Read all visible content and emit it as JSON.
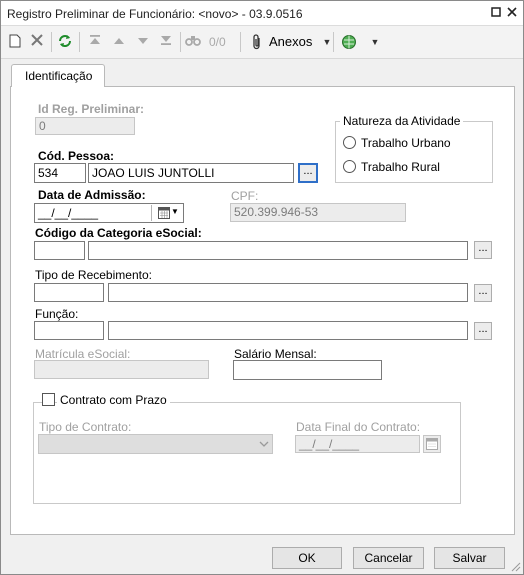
{
  "window": {
    "title": "Registro Preliminar de Funcionário: <novo> - 03.9.0516"
  },
  "toolbar": {
    "record_counter": "0/0",
    "attachments_label": "Anexos"
  },
  "tabs": [
    {
      "label": "Identificação"
    }
  ],
  "form": {
    "id_reg_preliminar": {
      "label": "Id Reg. Preliminar:",
      "value": "0"
    },
    "natureza": {
      "legend": "Natureza da Atividade",
      "options": [
        "Trabalho Urbano",
        "Trabalho Rural"
      ]
    },
    "cod_pessoa": {
      "label": "Cód. Pessoa:",
      "code": "534",
      "name": "JOAO LUIS JUNTOLLI"
    },
    "data_admissao": {
      "label": "Data de Admissão:",
      "placeholder": "__/__/____"
    },
    "cpf": {
      "label": "CPF:",
      "value": "520.399.946-53"
    },
    "categoria": {
      "label": "Código da Categoria eSocial:"
    },
    "tipo_recebimento": {
      "label": "Tipo de Recebimento:"
    },
    "funcao": {
      "label": "Função:"
    },
    "matricula": {
      "label": "Matrícula eSocial:"
    },
    "salario": {
      "label": "Salário Mensal:"
    },
    "contrato": {
      "legend": "Contrato com Prazo",
      "tipo_label": "Tipo de Contrato:",
      "data_final_label": "Data Final do Contrato:",
      "data_final_placeholder": "__/__/____"
    }
  },
  "lookup_button": "...",
  "buttons": {
    "ok": "OK",
    "cancel": "Cancelar",
    "save": "Salvar"
  }
}
